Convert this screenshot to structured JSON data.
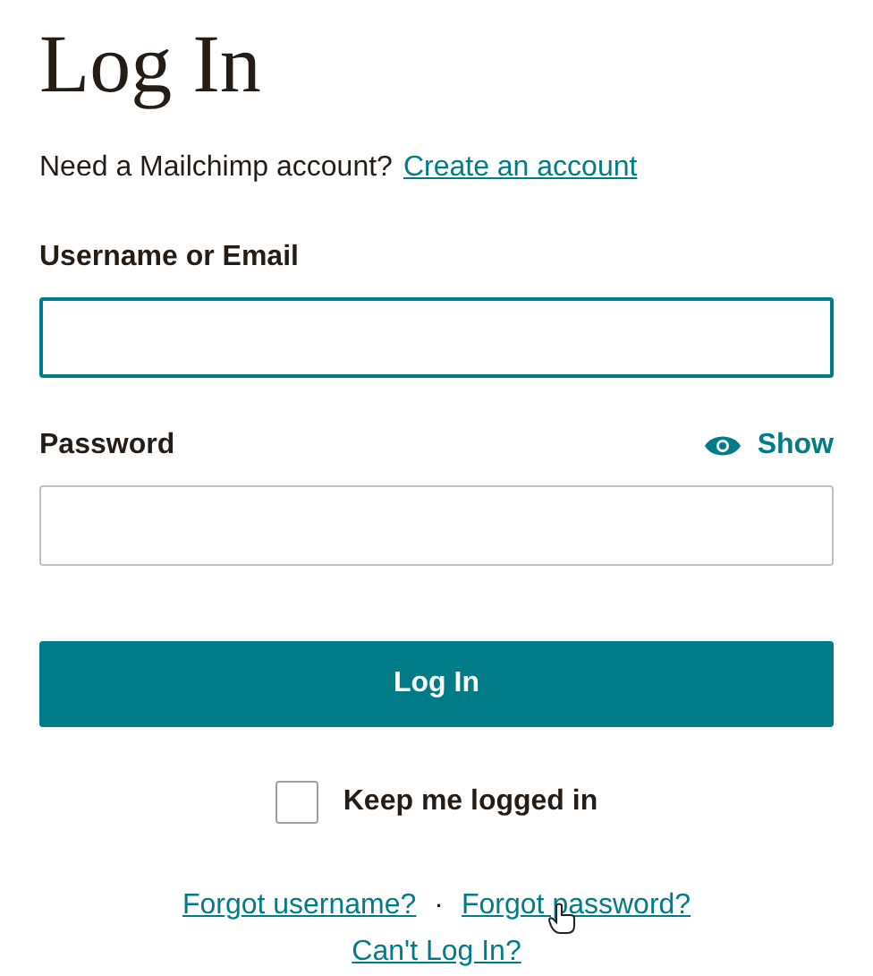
{
  "title": "Log In",
  "signup": {
    "prompt": "Need a Mailchimp account?",
    "link": "Create an account"
  },
  "fields": [
    {
      "label": "Username or Email",
      "focused": true
    },
    {
      "label": "Password",
      "focused": false,
      "toggle": "Show"
    }
  ],
  "submit": "Log In",
  "remember": {
    "label": "Keep me logged in",
    "checked": false
  },
  "links": [
    "Forgot username?",
    "Forgot password?"
  ],
  "separator": "·",
  "help_link": "Can't Log In?"
}
